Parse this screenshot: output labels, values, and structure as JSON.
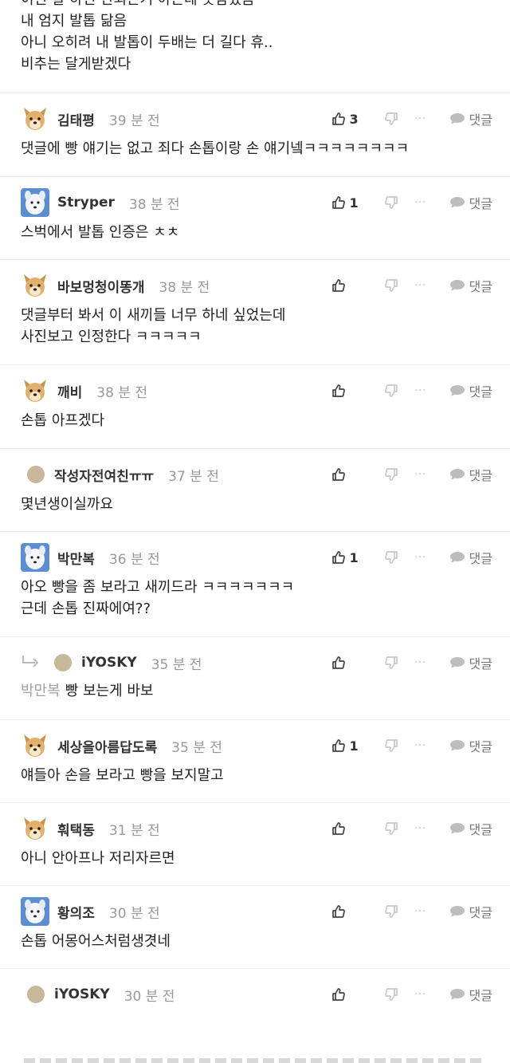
{
  "post": {
    "lines": [
      "이런 말 하면 안되는거 아는데 못참겠음",
      "내 엄지 발톱 닮음",
      "아니 오히려 내 발톱이 두배는 더 길다 휴..",
      "비추는 달게받겠다"
    ]
  },
  "labels": {
    "reply": "댓글",
    "more": "···"
  },
  "comments": [
    {
      "author": "김태평",
      "time": "39 분 전",
      "likes": "3",
      "avatar": "dog-avatar",
      "text": [
        "댓글에 빵 얘기는 없고 죄다 손톱이랑 손 얘기넼ㅋㅋㅋㅋㅋㅋㅋㅋ"
      ]
    },
    {
      "author": "Stryper",
      "time": "38 분 전",
      "likes": "1",
      "avatar": "white-dog-avatar",
      "text": [
        "스벅에서 발톱 인증은 ㅊㅊ"
      ]
    },
    {
      "author": "바보멍청이똥개",
      "time": "38 분 전",
      "likes": "",
      "avatar": "dog-avatar",
      "text": [
        "댓글부터 봐서 이 새끼들 너무 하네 싶었는데",
        "사진보고 인정한다 ㅋㅋㅋㅋㅋ"
      ]
    },
    {
      "author": "깨비",
      "time": "38 분 전",
      "likes": "",
      "avatar": "dog-avatar",
      "text": [
        "손톱 아프겠다"
      ]
    },
    {
      "author": "작성자전여친ㅠㅠ",
      "time": "37 분 전",
      "likes": "",
      "avatar": "dot-avatar",
      "text": [
        "몇년생이실까요"
      ]
    },
    {
      "author": "박만복",
      "time": "36 분 전",
      "likes": "1",
      "avatar": "white-dog-avatar",
      "text": [
        "아오 빵을 좀 보라고 새끼드라 ㅋㅋㅋㅋㅋㅋㅋ",
        "근데 손톱 진짜에여??"
      ]
    },
    {
      "author": "iYOSKY",
      "time": "35 분 전",
      "likes": "",
      "avatar": "dot-avatar",
      "reply": true,
      "mention": "박만복",
      "text": [
        "빵 보는게 바보"
      ]
    },
    {
      "author": "세상을아름답도록",
      "time": "35 분 전",
      "likes": "1",
      "avatar": "dog-avatar",
      "text": [
        "얘들아 손을 보라고 빵을 보지말고"
      ]
    },
    {
      "author": "훠택동",
      "time": "31 분 전",
      "likes": "",
      "avatar": "dog-avatar",
      "text": [
        "아니 안아프나 저리자르면"
      ]
    },
    {
      "author": "황의조",
      "time": "30 분 전",
      "likes": "",
      "avatar": "white-dog-avatar",
      "text": [
        "손톱 어몽어스처럼생겻네"
      ]
    },
    {
      "author": "iYOSKY",
      "time": "30 분 전",
      "likes": "",
      "avatar": "dot-avatar",
      "text": []
    }
  ],
  "colors": {
    "text": "#222222",
    "meta": "#999999",
    "divider": "#ececec",
    "mention": "#a0a0a0"
  }
}
